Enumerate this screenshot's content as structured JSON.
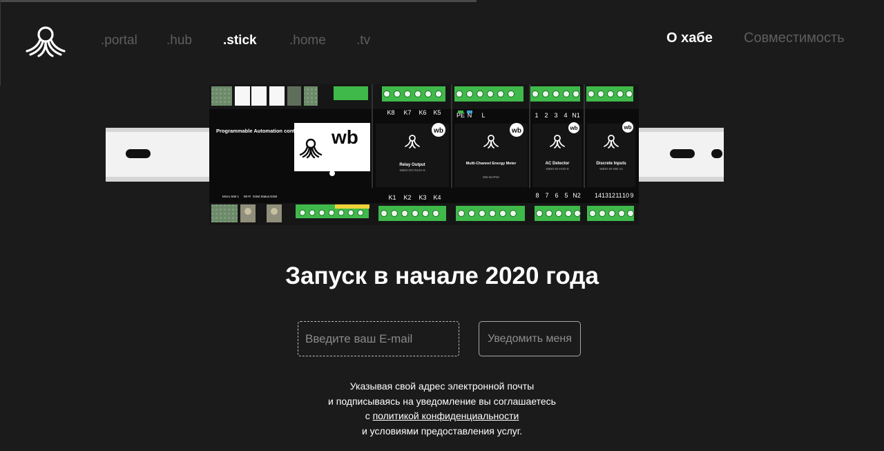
{
  "nav": {
    "items": [
      ".portal",
      ".hub",
      ".stick",
      ".home",
      ".tv"
    ],
    "active": ".stick"
  },
  "right_nav": {
    "about": "О хабе",
    "compat": "Совместимость"
  },
  "device": {
    "brand": "wb",
    "controller_title": "Programmable Automation controller",
    "modules": [
      {
        "title": "Relay Output",
        "model": "WBIO-DO-R10A-8"
      },
      {
        "title": "Multi-Channel Energy Meter",
        "model": "WB-MAP6S"
      },
      {
        "title": "AC Detector",
        "model": "WBIO-DI-HVD-8"
      },
      {
        "title": "Discrete Inputs",
        "model": "WBIO-DI-WD-14"
      }
    ],
    "relay_top": [
      "K8",
      "K7",
      "K6",
      "K5"
    ],
    "relay_bottom": [
      "K1",
      "K2",
      "K3",
      "K4"
    ],
    "ac_top": [
      "1",
      "2",
      "3",
      "4",
      "N1"
    ],
    "ac_bottom": [
      "8",
      "7",
      "6",
      "5",
      "N2"
    ],
    "di_bottom": [
      "14",
      "13",
      "12",
      "11",
      "10",
      "9"
    ],
    "meter_top": [
      "PE",
      "N",
      "L"
    ],
    "ctrl_bottom": [
      "Micro SIM 1",
      "Wi-Fi",
      "GSM Status",
      "GSM"
    ]
  },
  "hero": {
    "headline": "Запуск в начале 2020 года"
  },
  "form": {
    "email_placeholder": "Введите ваш E-mail",
    "button": "Уведомить меня"
  },
  "legal": {
    "line1": "Указывая свой адрес электронной почты",
    "line2": "и подписываясь на уведомление вы соглашаетесь",
    "line3_prefix": "с ",
    "policy_link": "политикой конфиденциальности",
    "line4": "и условиями предоставления услуг."
  }
}
